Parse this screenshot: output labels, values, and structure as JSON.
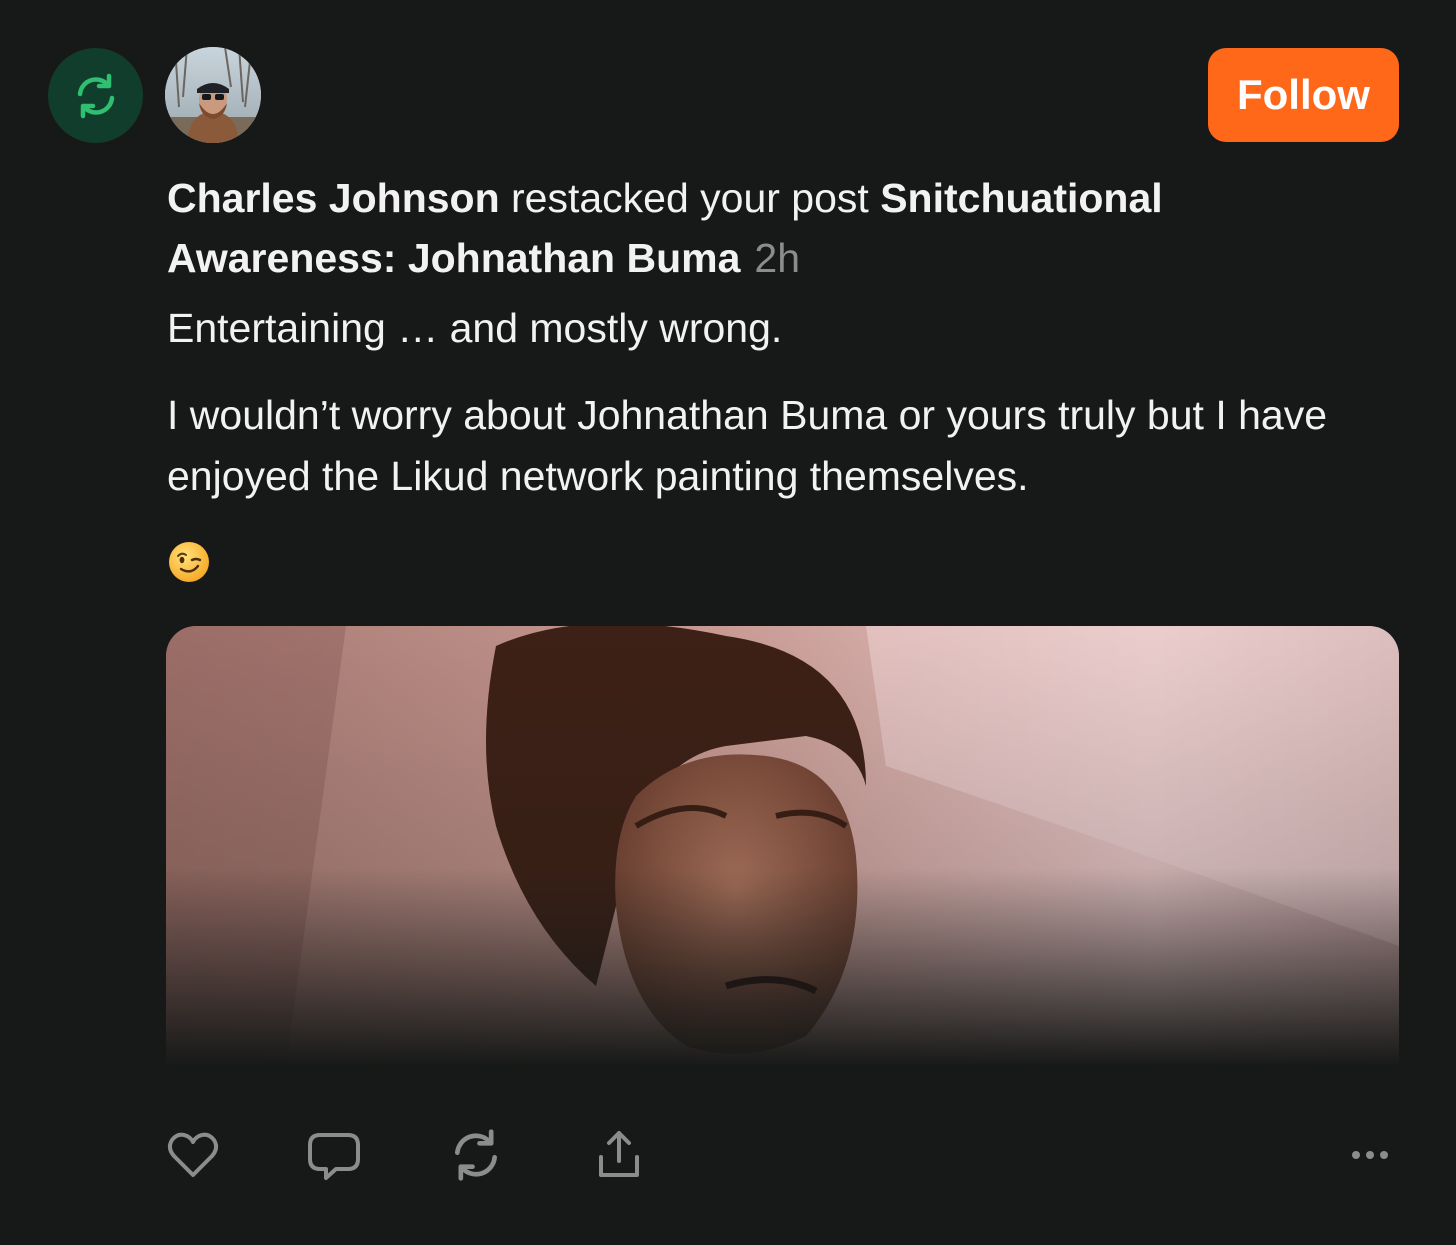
{
  "restack": {
    "icon": "restack-icon",
    "badge_color": "#103d2c",
    "icon_color": "#2fbf71"
  },
  "author_avatar": {
    "icon": "avatar"
  },
  "follow_button": {
    "label": "Follow",
    "color": "#ff6719"
  },
  "notification": {
    "actor": "Charles Johnson",
    "action_text": " restacked your post ",
    "post_title": "Snitchuational Awareness: Johnathan Buma",
    "time": "2h"
  },
  "note": {
    "paragraph_1": "Entertaining … and mostly wrong.",
    "paragraph_2": "I wouldn’t worry about Johnathan Buma or yours truly but I have enjoyed the Likud network painting themselves.",
    "emoji": "😉"
  },
  "media": {
    "icon": "video-thumbnail"
  },
  "actions": {
    "like_icon": "heart-icon",
    "comment_icon": "comment-icon",
    "restack_icon": "restack-icon",
    "share_icon": "share-icon",
    "more_icon": "more-icon",
    "icon_color": "#8a8d8c"
  }
}
